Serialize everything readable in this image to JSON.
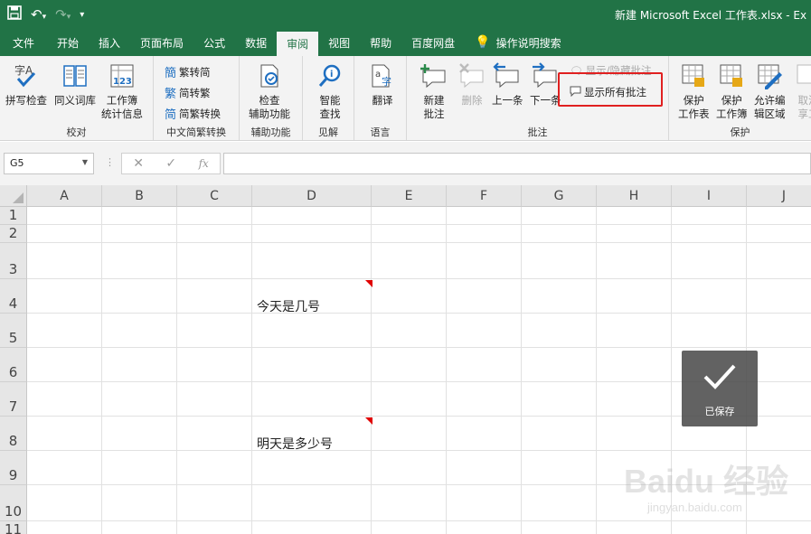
{
  "titlebar": {
    "doc_title": "新建 Microsoft Excel 工作表.xlsx  -  Ex",
    "qat": [
      "save-icon",
      "undo-icon",
      "redo-icon",
      "customize-icon"
    ]
  },
  "tabs": [
    "文件",
    "开始",
    "插入",
    "页面布局",
    "公式",
    "数据",
    "审阅",
    "视图",
    "帮助",
    "百度网盘",
    "操作说明搜索"
  ],
  "active_tab": "审阅",
  "ribbon": {
    "groups": {
      "proof": "校对",
      "chinese": "中文简繁转换",
      "access": "辅助功能",
      "insights": "见解",
      "language": "语言",
      "comments": "批注",
      "protect": "保护"
    },
    "buttons": {
      "spell": "拼写检查",
      "thesaurus": "同义词库",
      "stats_l1": "工作簿",
      "stats_l2": "统计信息",
      "trad_to_simp": "繁转简",
      "simp_to_trad": "简转繁",
      "convert": "简繁转换",
      "check_l1": "检查",
      "check_l2": "辅助功能",
      "smart_l1": "智能",
      "smart_l2": "查找",
      "translate": "翻译",
      "new_l1": "新建",
      "new_l2": "批注",
      "delete": "删除",
      "prev": "上一条",
      "next": "下一条",
      "show_hide": "显示/隐藏批注",
      "show_all": "显示所有批注",
      "prot_sheet_l1": "保护",
      "prot_sheet_l2": "工作表",
      "prot_book_l1": "保护",
      "prot_book_l2": "工作簿",
      "allow_l1": "允许编",
      "allow_l2": "辑区域",
      "unshare_l1": "取消",
      "unshare_l2": "享工"
    }
  },
  "formula_bar": {
    "namebox": "G5",
    "fx": "fx",
    "value": ""
  },
  "grid": {
    "columns": [
      "A",
      "B",
      "C",
      "D",
      "E",
      "F",
      "G",
      "H",
      "I",
      "J"
    ],
    "rows": [
      "1",
      "2",
      "3",
      "4",
      "5",
      "6",
      "7",
      "8",
      "9",
      "10",
      "11"
    ],
    "cells": {
      "D4": "今天是几号",
      "D8": "明天是多少号"
    }
  },
  "toast": {
    "label": "已保存"
  },
  "watermark": {
    "brand": "Baidu 经验",
    "url": "jingyan.baidu.com"
  },
  "colors": {
    "excel_green": "#217346",
    "ribbon_bg": "#f3f3f3",
    "highlight": "#e02020",
    "comment_marker": "#e00000"
  }
}
